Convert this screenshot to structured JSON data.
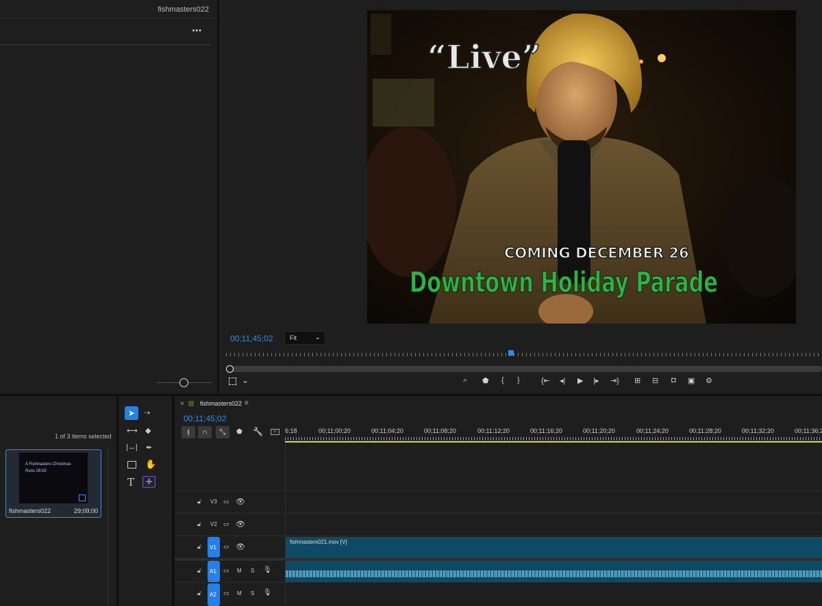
{
  "source_panel": {
    "sequence_name": "fishmasters022",
    "more_label": "•••"
  },
  "program_monitor": {
    "timecode": "00;11;45;02",
    "fit_label": "Fit",
    "video": {
      "live_text": "“Live”",
      "coming_text": "COMING DECEMBER 26",
      "parade_text": "Downtown Holiday Parade"
    }
  },
  "project_panel": {
    "selection_status": "1 of 3 items selected",
    "item": {
      "thumb_line1": "A Fishmasters Christmas",
      "thumb_line2": "Runs 28:55",
      "name": "fishmasters022",
      "duration": "29;09;00"
    }
  },
  "timeline": {
    "tab_name": "fishmasters022",
    "close_label": "×",
    "menu_label": "≡",
    "timecode": "00;11;45;02",
    "ruler_labels": [
      "6;18",
      "00;11;00;20",
      "00;11;04;20",
      "00;11;08;20",
      "00;11;12;20",
      "00;11;16;20",
      "00;11;20;20",
      "00;11;24;20",
      "00;11;28;20",
      "00;11;32;20",
      "00;11;36;2"
    ],
    "tracks": {
      "v3": "V3",
      "v2": "V2",
      "v1": "V1",
      "a1": "A1",
      "a2": "A2",
      "mute": "M",
      "solo": "S"
    },
    "clip_v1": "fishmasters021.mov [V]"
  },
  "colors": {
    "accent": "#2680eb",
    "clip_video": "#0e4a63",
    "clip_audio": "#0e4a63",
    "playhead": "#2d8ceb",
    "work_area": "#e0d64a"
  }
}
